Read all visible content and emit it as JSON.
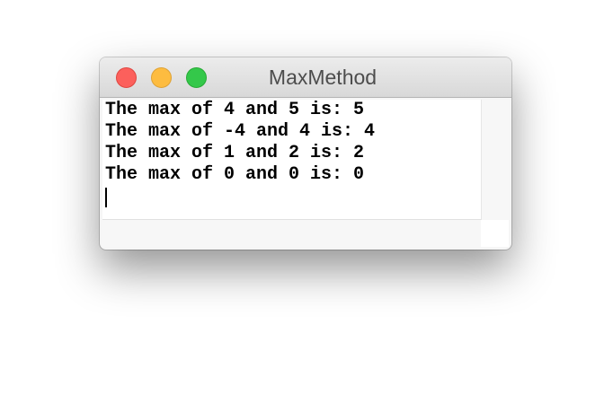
{
  "window": {
    "title": "MaxMethod"
  },
  "output": {
    "lines": [
      "The max of 4 and 5 is: 5",
      "The max of -4 and 4 is: 4",
      "The max of 1 and 2 is: 2",
      "The max of 0 and 0 is: 0"
    ]
  },
  "colors": {
    "close": "#fc605c",
    "minimize": "#fdbc40",
    "zoom": "#34c84a"
  }
}
